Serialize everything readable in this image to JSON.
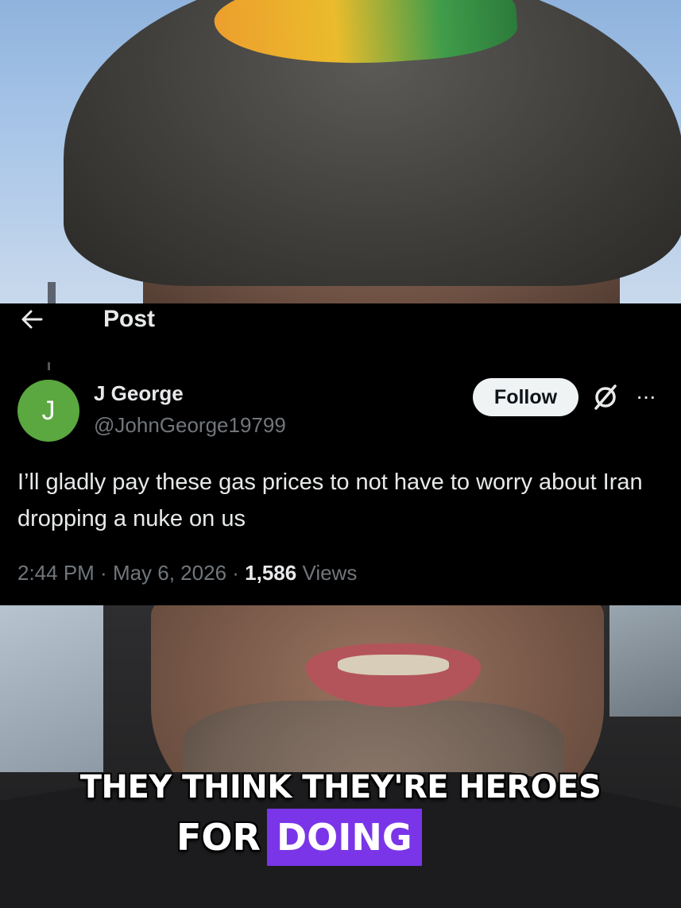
{
  "post_header": {
    "title": "Post",
    "back_icon": "arrow-left-icon"
  },
  "author": {
    "avatar_letter": "J",
    "avatar_color": "#5aa83f",
    "display_name": "J George",
    "handle": "@JohnGeorge19799"
  },
  "actions": {
    "follow_label": "Follow",
    "grok_icon": "grok-icon",
    "more_icon": "more-dots-icon",
    "more_glyph": "···"
  },
  "tweet": {
    "text": "I’ll gladly pay these gas prices to not have to worry about Iran dropping a nuke on us",
    "time": "2:44 PM",
    "sep1": " · ",
    "date": "May 6, 2026",
    "sep2": " · ",
    "views_count": "1,586",
    "views_label": " Views"
  },
  "caption": {
    "line1": "THEY THINK THEY'RE HEROES",
    "line2_plain": "FOR",
    "line2_highlight": "DOING",
    "highlight_color": "#7a35e8"
  }
}
